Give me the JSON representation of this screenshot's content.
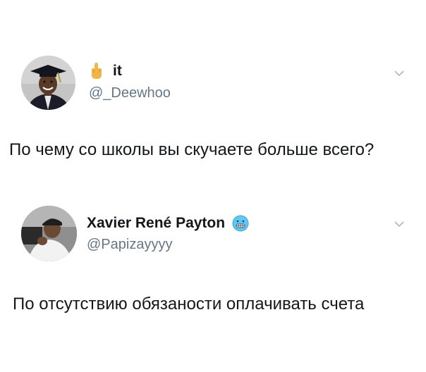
{
  "tweets": [
    {
      "display_name": "it",
      "name_emoji": "middle-finger-icon",
      "handle": "@_Deewhoo",
      "text": "По чему со школы вы скучаете больше всего?"
    },
    {
      "display_name": "Xavier René Payton",
      "name_emoji": "grimacing-cold-face-icon",
      "handle": "@Papizayyyy",
      "text": "По отсутствию обязаности оплачивать счета"
    }
  ],
  "colors": {
    "text": "#14171a",
    "handle": "#657786",
    "chevron": "#aab8c2",
    "emoji_blue": "#63c7f0"
  }
}
